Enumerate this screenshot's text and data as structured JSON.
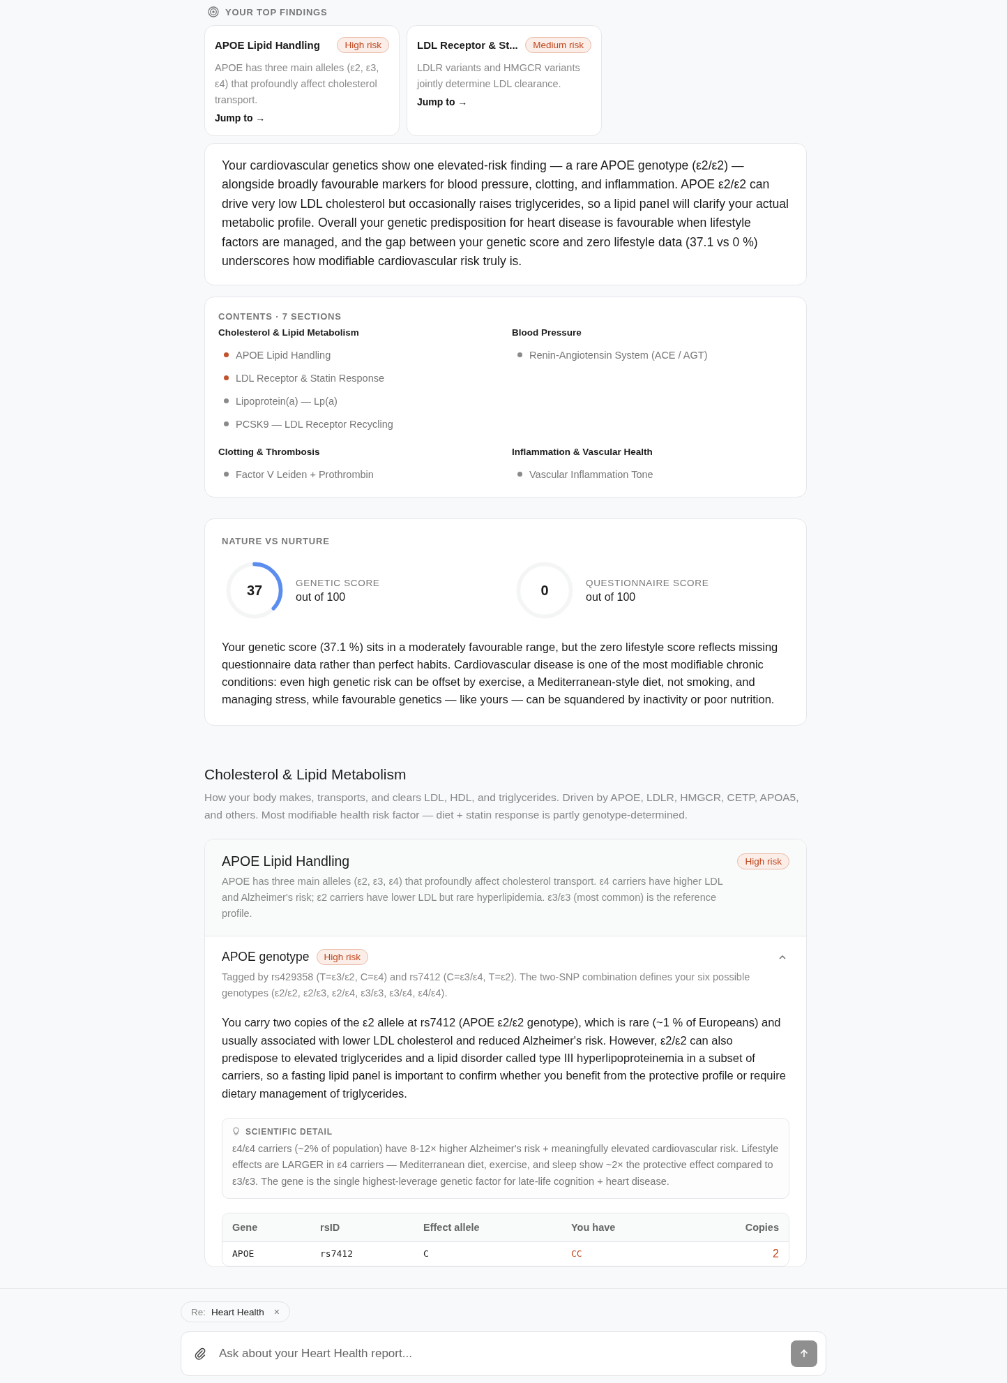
{
  "top_findings": {
    "heading": "YOUR TOP FINDINGS",
    "cards": [
      {
        "title": "APOE Lipid Handling",
        "badge": "High risk",
        "text": "APOE has three main alleles (ε2, ε3, ε4) that profoundly affect cholesterol transport.",
        "link": "Jump to",
        "arrow": "→"
      },
      {
        "title": "LDL Receptor & St...",
        "badge": "Medium risk",
        "text": "LDLR variants and HMGCR variants jointly determine LDL clearance.",
        "link": "Jump to",
        "arrow": "→"
      }
    ]
  },
  "summary": "Your cardiovascular genetics show one elevated-risk finding — a rare APOE genotype (ε2/ε2) — alongside broadly favourable markers for blood pressure, clotting, and inflammation. APOE ε2/ε2 can drive very low LDL cholesterol but occasionally raises triglycerides, so a lipid panel will clarify your actual metabolic profile. Overall your genetic predisposition for heart disease is favourable when lifestyle factors are managed, and the gap between your genetic score and zero lifestyle data (37.1 vs 0 %) underscores how modifiable cardiovascular risk truly is.",
  "contents": {
    "heading": "CONTENTS · 7 SECTIONS",
    "groups": [
      {
        "title": "Cholesterol & Lipid Metabolism",
        "items": [
          {
            "label": "APOE Lipid Handling",
            "color": "#c2522d"
          },
          {
            "label": "LDL Receptor & Statin Response",
            "color": "#c2522d"
          },
          {
            "label": "Lipoprotein(a) — Lp(a)",
            "color": "#8a8a8a"
          },
          {
            "label": "PCSK9 — LDL Receptor Recycling",
            "color": "#8a8a8a"
          }
        ]
      },
      {
        "title": "Blood Pressure",
        "items": [
          {
            "label": "Renin-Angiotensin System (ACE / AGT)",
            "color": "#8a8a8a"
          }
        ]
      },
      {
        "title": "Clotting & Thrombosis",
        "items": [
          {
            "label": "Factor V Leiden + Prothrombin",
            "color": "#8a8a8a"
          }
        ]
      },
      {
        "title": "Inflammation & Vascular Health",
        "items": [
          {
            "label": "Vascular Inflammation Tone",
            "color": "#8a8a8a"
          }
        ]
      }
    ]
  },
  "nature_vs_nurture": {
    "heading": "NATURE VS NURTURE",
    "scores": [
      {
        "value": "37",
        "label": "GENETIC SCORE",
        "sub": "out of 100"
      },
      {
        "value": "0",
        "label": "QUESTIONNAIRE SCORE",
        "sub": "out of 100"
      }
    ],
    "text": "Your genetic score (37.1 %) sits in a moderately favourable range, but the zero lifestyle score reflects missing questionnaire data rather than perfect habits. Cardiovascular disease is one of the most modifiable chronic conditions: even high genetic risk can be offset by exercise, a Mediterranean-style diet, not smoking, and managing stress, while favourable genetics — like yours — can be squandered by inactivity or poor nutrition."
  },
  "section": {
    "title": "Cholesterol & Lipid Metabolism",
    "description": "How your body makes, transports, and clears LDL, HDL, and triglycerides. Driven by APOE, LDLR, HMGCR, CETP, APOA5, and others. Most modifiable health risk factor — diet + statin response is partly genotype-determined.",
    "topic": {
      "title": "APOE Lipid Handling",
      "badge": "High risk",
      "text": "APOE has three main alleles (ε2, ε3, ε4) that profoundly affect cholesterol transport. ε4 carriers have higher LDL and Alzheimer's risk; ε2 carriers have lower LDL but rare hyperlipidemia. ε3/ε3 (most common) is the reference profile.",
      "marker": {
        "title": "APOE genotype",
        "badge": "High risk",
        "expanded": true,
        "tagline": "Tagged by rs429358 (T=ε3/ε2, C=ε4) and rs7412 (C=ε3/ε4, T=ε2). The two-SNP combination defines your six possible genotypes (ε2/ε2, ε2/ε3, ε2/ε4, ε3/ε3, ε3/ε4, ε4/ε4).",
        "interpretation": "You carry two copies of the ε2 allele at rs7412 (APOE ε2/ε2 genotype), which is rare (~1 % of Europeans) and usually associated with lower LDL cholesterol and reduced Alzheimer's risk. However, ε2/ε2 can also predispose to elevated triglycerides and a lipid disorder called type III hyperlipoproteinemia in a subset of carriers, so a fasting lipid panel is important to confirm whether you benefit from the protective profile or require dietary management of triglycerides.",
        "detail": {
          "heading": "SCIENTIFIC DETAIL",
          "text": "ε4/ε4 carriers (~2% of population) have 8-12× higher Alzheimer's risk + meaningfully elevated cardiovascular risk. Lifestyle effects are LARGER in ε4 carriers — Mediterranean diet, exercise, and sleep show ~2× the protective effect compared to ε3/ε3. The gene is the single highest-leverage genetic factor for late-life cognition + heart disease."
        },
        "table": {
          "columns": [
            "Gene",
            "rsID",
            "Effect allele",
            "You have",
            "Copies"
          ],
          "rows": [
            {
              "cells": [
                "APOE",
                "rs7412",
                "C",
                "CC",
                "2"
              ],
              "flagged": true
            }
          ]
        }
      }
    }
  },
  "chat": {
    "context_label": "Re:",
    "context": "Heart Health",
    "remove": "×",
    "placeholder": "Ask about your Heart Health report..."
  }
}
